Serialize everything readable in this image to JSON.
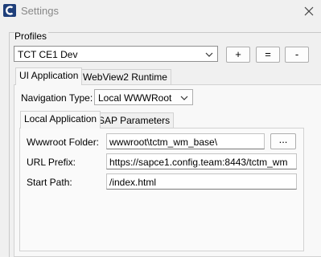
{
  "window": {
    "title": "Settings"
  },
  "profiles": {
    "group_label": "Profiles",
    "selected": "TCT CE1 Dev",
    "add_label": "+",
    "equals_label": "=",
    "remove_label": "-"
  },
  "outer_tabs": [
    {
      "label": "UI Application"
    },
    {
      "label": "WebView2 Runtime"
    }
  ],
  "navigation": {
    "label": "Navigation Type:",
    "selected": "Local WWWRoot"
  },
  "inner_tabs": [
    {
      "label": "Local Application"
    },
    {
      "label": "SAP Parameters"
    }
  ],
  "fields": {
    "wwwroot": {
      "label": "Wwwroot Folder:",
      "value": "wwwroot\\tctm_wm_base\\",
      "browse_label": "..."
    },
    "url_prefix": {
      "label": "URL Prefix:",
      "value": "https://sapce1.config.team:8443/tctm_wm"
    },
    "start_path": {
      "label": "Start Path:",
      "value": "/index.html"
    }
  },
  "colors": {
    "icon_bg": "#1f3f7a"
  },
  "icons": {
    "app": "app-logo-icon",
    "close": "close-icon",
    "dropdown": "chevron-down-icon"
  }
}
